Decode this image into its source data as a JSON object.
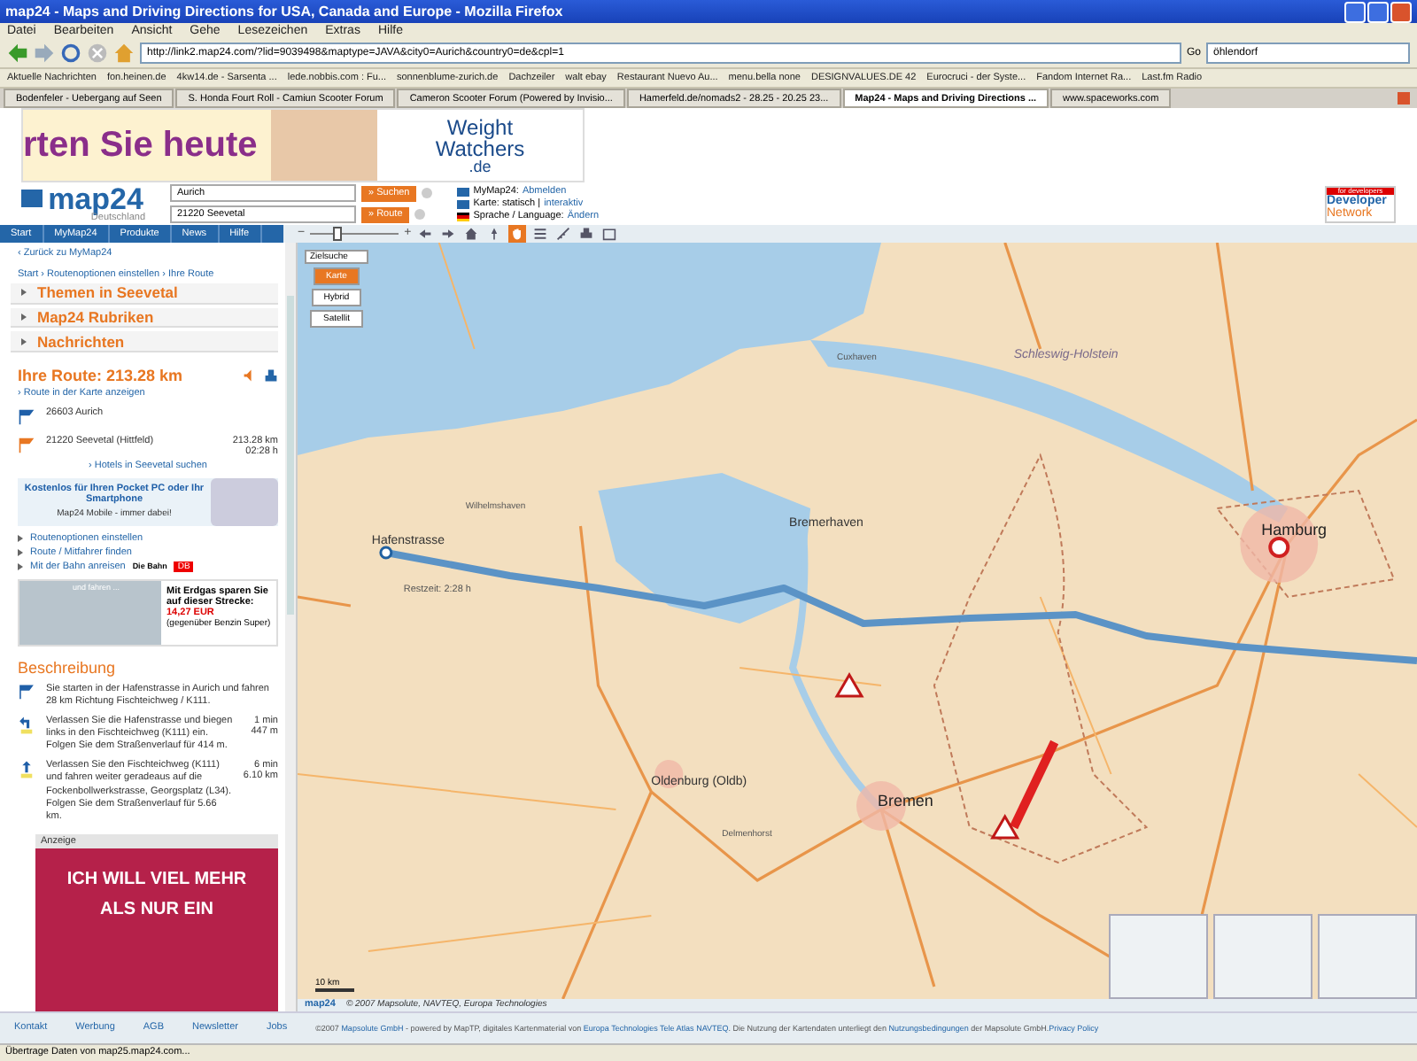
{
  "browser": {
    "title": "map24 - Maps and Driving Directions for USA, Canada and Europe - Mozilla Firefox",
    "menu": [
      "Datei",
      "Bearbeiten",
      "Ansicht",
      "Gehe",
      "Lesezeichen",
      "Extras",
      "Hilfe"
    ],
    "url": "http://link2.map24.com/?lid=9039498&maptype=JAVA&city0=Aurich&country0=de&cpl=1",
    "go": "Go",
    "search": "öhlendorf",
    "bookmarks": [
      "Aktuelle Nachrichten",
      "fon.heinen.de",
      "4kw14.de - Sarsenta ...",
      "lede.nobbis.com : Fu...",
      "sonnenblume-zurich.de",
      "Dachzeiler",
      "walt ebay",
      "Restaurant Nuevo Au...",
      "menu.bella none",
      "DESIGNVALUES.DE 42",
      "Eurocruci - der Syste...",
      "Fandom Internet Ra...",
      "Last.fm Radio"
    ],
    "tabs": [
      {
        "label": "Bodenfeler - Uebergang auf Seen",
        "selected": false
      },
      {
        "label": "S. Honda Fourt Roll - Camiun Scooter Forum",
        "selected": false
      },
      {
        "label": "Cameron Scooter Forum (Powered by Invisio...",
        "selected": false
      },
      {
        "label": "Hamerfeld.de/nomads2 - 28.25 - 20.25 23...",
        "selected": false
      },
      {
        "label": "Map24 - Maps and Driving Directions ...",
        "selected": true
      },
      {
        "label": "www.spaceworks.com",
        "selected": false
      }
    ],
    "status": "Übertrage Daten von map25.map24.com..."
  },
  "ad_banner": {
    "slogan": "rten Sie heute",
    "brand": "Weight",
    "brand2": "Watchers",
    "tld": ".de"
  },
  "header": {
    "logo": "map24",
    "logo_sub": "Deutschland",
    "fields": [
      {
        "value": "Aurich",
        "button": "» Suchen"
      },
      {
        "value": "21220 Seevetal",
        "button": "» Route"
      }
    ],
    "links": [
      {
        "label": "MyMap24:",
        "link": "Abmelden"
      },
      {
        "label": "Karte: statisch |",
        "link": "interaktiv"
      },
      {
        "label": "Sprache / Language:",
        "link": "Ändern"
      }
    ],
    "dev_badge": {
      "tag": "for developers",
      "line1": "Developer",
      "line2": "Network"
    }
  },
  "nav": [
    {
      "label": "Start",
      "selected": false
    },
    {
      "label": "MyMap24",
      "selected": false
    },
    {
      "label": "Produkte",
      "selected": false
    },
    {
      "label": "News",
      "selected": false
    },
    {
      "label": "Hilfe",
      "selected": false
    }
  ],
  "map_tools": {
    "zoom": {
      "minus": "−",
      "plus": "+",
      "level": 0.3
    },
    "tools": [
      {
        "kind": "back",
        "selected": false
      },
      {
        "kind": "forward",
        "selected": false
      },
      {
        "kind": "home",
        "selected": false
      },
      {
        "kind": "pin",
        "selected": false
      },
      {
        "kind": "hand",
        "selected": true
      },
      {
        "kind": "layers",
        "selected": false
      },
      {
        "kind": "measure",
        "selected": false
      },
      {
        "kind": "print",
        "selected": false
      },
      {
        "kind": "window",
        "selected": false
      }
    ]
  },
  "sidebar": {
    "back_link": "‹ Zurück zu MyMap24",
    "breadcrumb": "Start › Routenoptionen einstellen › Ihre Route",
    "sections": [
      {
        "label": "Themen in Seevetal",
        "expanded": false
      },
      {
        "label": "Map24 Rubriken",
        "expanded": false
      },
      {
        "label": "Nachrichten",
        "expanded": false
      }
    ],
    "route_title": "Ihre Route: 213.28 km",
    "show_link": "› Route in der Karte anzeigen",
    "stops": [
      {
        "kind": "start",
        "place": "26603 Aurich"
      },
      {
        "kind": "end",
        "place": "21220 Seevetal (Hittfeld)",
        "distance": "213.28 km",
        "time": "02:28 h"
      }
    ],
    "hotel_link": "› Hotels in Seevetal suchen",
    "mobile_ad": {
      "headline": "Kostenlos für Ihren Pocket PC oder Ihr Smartphone",
      "tagline": "Map24 Mobile - immer dabei!"
    },
    "links": [
      "Routenoptionen einstellen",
      "Route / Mitfahrer finden",
      "Mit der Bahn anreisen"
    ],
    "bahn": {
      "name": "Die Bahn",
      "logo": "DB"
    },
    "gas_ad": {
      "text": "Mit Erdgas sparen Sie auf dieser Strecke:",
      "amount": "14,27 EUR",
      "note": "(gegenüber Benzin Super)",
      "photo_caption": "und fahren ..."
    },
    "desc_title": "Beschreibung",
    "steps": [
      {
        "kind": "start",
        "text": "Sie starten in der Hafenstrasse in Aurich und fahren 28 km Richtung Fischteichweg / K111."
      },
      {
        "kind": "left",
        "text": "Verlassen Sie die Hafenstrasse und biegen links in den Fischteichweg (K111) ein. Folgen Sie dem Straßenverlauf für 414 m.",
        "time": "1 min",
        "distance": "447 m"
      },
      {
        "kind": "straight",
        "text": "Verlassen Sie den Fischteichweg (K111) und fahren weiter geradeaus auf die Fockenbollwerkstrasse, Georgsplatz (L34). Folgen Sie dem Straßenverlauf für 5.66 km.",
        "time": "6 min",
        "distance": "6.10 km"
      }
    ],
    "ad_label": "Anzeige",
    "ad_lines": [
      "ICH WILL VIEL MEHR",
      "ALS NUR EIN"
    ]
  },
  "map": {
    "dropdown": "Zielsuche",
    "views": [
      {
        "label": "Karte",
        "selected": true
      },
      {
        "label": "Hybrid",
        "selected": false
      },
      {
        "label": "Satellit",
        "selected": false
      }
    ],
    "places": [
      {
        "name": "Hamburg",
        "kind": "city"
      },
      {
        "name": "Bremen",
        "kind": "city"
      },
      {
        "name": "Bremerhaven",
        "kind": "town"
      },
      {
        "name": "Oldenburg (Oldb)",
        "kind": "town"
      },
      {
        "name": "Cuxhaven",
        "kind": "small"
      },
      {
        "name": "Wilhelmshaven",
        "kind": "small"
      },
      {
        "name": "Delmenhorst",
        "kind": "small"
      },
      {
        "name": "Schleswig-Holstein",
        "kind": "region"
      },
      {
        "name": "Hafenstrasse",
        "kind": "route"
      }
    ],
    "route_tip": "Restzeit: 2:28 h",
    "scale": "10 km",
    "logo": "map24",
    "copyright": "© 2007 Mapsolute, NAVTEQ, Europa Technologies"
  },
  "footer": {
    "links": [
      "Kontakt",
      "Werbung",
      "AGB",
      "Newsletter",
      "Jobs"
    ],
    "legal": [
      {
        "text": "©2007 ",
        "link": false
      },
      {
        "text": "Mapsolute GmbH",
        "link": true
      },
      {
        "text": " - powered by MapTP, digitales Kartenmaterial von ",
        "link": false
      },
      {
        "text": "Europa Technologies",
        "link": true
      },
      {
        "text": " Tele Atlas",
        "link": true
      },
      {
        "text": " NAVTEQ",
        "link": true
      },
      {
        "text": ". Die Nutzung der Kartendaten unterliegt den ",
        "link": false
      },
      {
        "text": "Nutzungsbedingungen",
        "link": true
      },
      {
        "text": " der Mapsolute GmbH.",
        "link": false
      },
      {
        "text": "Privacy Policy",
        "link": true
      }
    ]
  }
}
